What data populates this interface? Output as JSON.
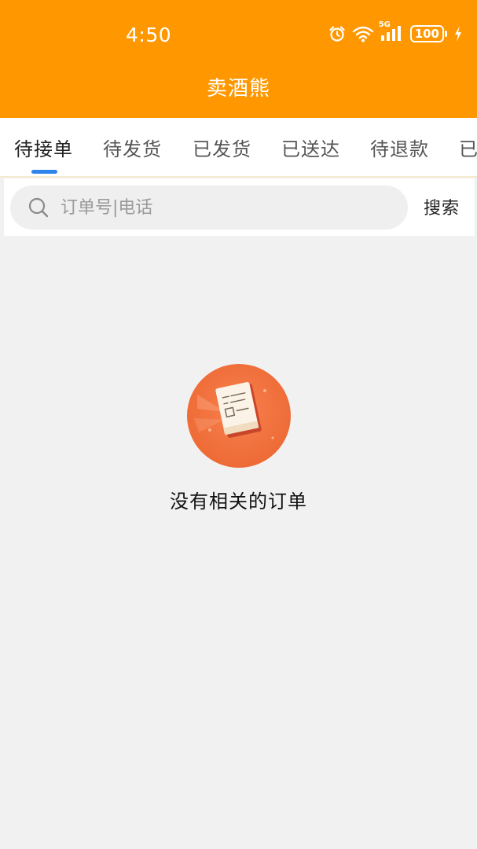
{
  "status_bar": {
    "time": "4:50",
    "network": "5G",
    "battery": "100",
    "icons": [
      "alarm-icon",
      "wifi-icon",
      "signal-icon",
      "battery-icon",
      "charging-icon"
    ]
  },
  "header": {
    "title": "卖酒熊",
    "color": "#ff9800"
  },
  "tabs": {
    "items": [
      {
        "label": "待接单",
        "active": true
      },
      {
        "label": "待发货",
        "active": false
      },
      {
        "label": "已发货",
        "active": false
      },
      {
        "label": "已送达",
        "active": false
      },
      {
        "label": "待退款",
        "active": false
      },
      {
        "label": "已",
        "active": false
      }
    ],
    "indicator_color": "#2e86ea"
  },
  "search": {
    "placeholder": "订单号|电话",
    "value": "",
    "button_label": "搜索"
  },
  "empty": {
    "message": "没有相关的订单",
    "illustration": "empty-orders-icon"
  }
}
